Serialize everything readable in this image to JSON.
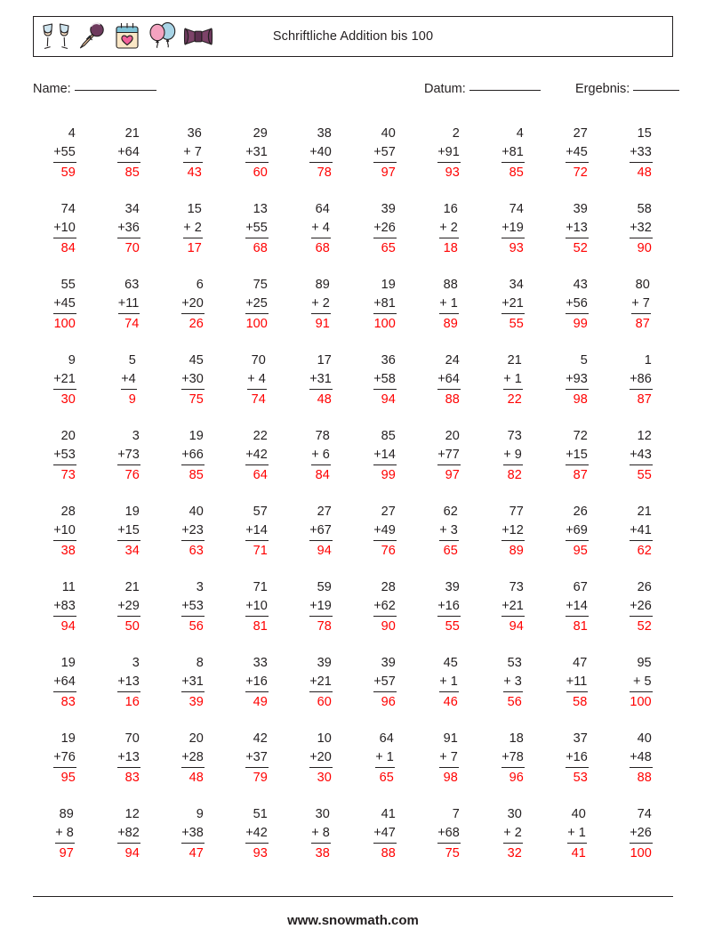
{
  "header": {
    "title": "Schriftliche Addition bis 100",
    "icons": [
      "champagne-glasses-icon",
      "microphone-icon",
      "calendar-heart-icon",
      "balloons-icon",
      "bow-tie-icon"
    ]
  },
  "meta": {
    "name_label": "Name:",
    "date_label": "Datum:",
    "score_label": "Ergebnis:",
    "name_value": "",
    "date_value": "",
    "score_value": ""
  },
  "footer": {
    "site": "www.snowmath.com"
  },
  "colors": {
    "ink": "#231f20",
    "answer": "#ff0000",
    "page": "#ffffff"
  },
  "worksheet": {
    "operator": "+",
    "columns": 10,
    "rows": 10,
    "total_problems": 100,
    "problems": [
      {
        "a": "4",
        "b": "55",
        "sum": "59"
      },
      {
        "a": "21",
        "b": "64",
        "sum": "85"
      },
      {
        "a": "36",
        "b": "7",
        "sum": "43"
      },
      {
        "a": "29",
        "b": "31",
        "sum": "60"
      },
      {
        "a": "38",
        "b": "40",
        "sum": "78"
      },
      {
        "a": "40",
        "b": "57",
        "sum": "97"
      },
      {
        "a": "2",
        "b": "91",
        "sum": "93"
      },
      {
        "a": "4",
        "b": "81",
        "sum": "85"
      },
      {
        "a": "27",
        "b": "45",
        "sum": "72"
      },
      {
        "a": "15",
        "b": "33",
        "sum": "48"
      },
      {
        "a": "74",
        "b": "10",
        "sum": "84"
      },
      {
        "a": "34",
        "b": "36",
        "sum": "70"
      },
      {
        "a": "15",
        "b": "2",
        "sum": "17"
      },
      {
        "a": "13",
        "b": "55",
        "sum": "68"
      },
      {
        "a": "64",
        "b": "4",
        "sum": "68"
      },
      {
        "a": "39",
        "b": "26",
        "sum": "65"
      },
      {
        "a": "16",
        "b": "2",
        "sum": "18"
      },
      {
        "a": "74",
        "b": "19",
        "sum": "93"
      },
      {
        "a": "39",
        "b": "13",
        "sum": "52"
      },
      {
        "a": "58",
        "b": "32",
        "sum": "90"
      },
      {
        "a": "55",
        "b": "45",
        "sum": "100"
      },
      {
        "a": "63",
        "b": "11",
        "sum": "74"
      },
      {
        "a": "6",
        "b": "20",
        "sum": "26"
      },
      {
        "a": "75",
        "b": "25",
        "sum": "100"
      },
      {
        "a": "89",
        "b": "2",
        "sum": "91"
      },
      {
        "a": "19",
        "b": "81",
        "sum": "100"
      },
      {
        "a": "88",
        "b": "1",
        "sum": "89"
      },
      {
        "a": "34",
        "b": "21",
        "sum": "55"
      },
      {
        "a": "43",
        "b": "56",
        "sum": "99"
      },
      {
        "a": "80",
        "b": "7",
        "sum": "87"
      },
      {
        "a": "9",
        "b": "21",
        "sum": "30"
      },
      {
        "a": "5",
        "b": "4",
        "sum": "9",
        "narrow": true
      },
      {
        "a": "45",
        "b": "30",
        "sum": "75"
      },
      {
        "a": "70",
        "b": "4",
        "sum": "74"
      },
      {
        "a": "17",
        "b": "31",
        "sum": "48"
      },
      {
        "a": "36",
        "b": "58",
        "sum": "94"
      },
      {
        "a": "24",
        "b": "64",
        "sum": "88"
      },
      {
        "a": "21",
        "b": "1",
        "sum": "22"
      },
      {
        "a": "5",
        "b": "93",
        "sum": "98"
      },
      {
        "a": "1",
        "b": "86",
        "sum": "87"
      },
      {
        "a": "20",
        "b": "53",
        "sum": "73"
      },
      {
        "a": "3",
        "b": "73",
        "sum": "76"
      },
      {
        "a": "19",
        "b": "66",
        "sum": "85"
      },
      {
        "a": "22",
        "b": "42",
        "sum": "64"
      },
      {
        "a": "78",
        "b": "6",
        "sum": "84"
      },
      {
        "a": "85",
        "b": "14",
        "sum": "99"
      },
      {
        "a": "20",
        "b": "77",
        "sum": "97"
      },
      {
        "a": "73",
        "b": "9",
        "sum": "82"
      },
      {
        "a": "72",
        "b": "15",
        "sum": "87"
      },
      {
        "a": "12",
        "b": "43",
        "sum": "55"
      },
      {
        "a": "28",
        "b": "10",
        "sum": "38"
      },
      {
        "a": "19",
        "b": "15",
        "sum": "34"
      },
      {
        "a": "40",
        "b": "23",
        "sum": "63"
      },
      {
        "a": "57",
        "b": "14",
        "sum": "71"
      },
      {
        "a": "27",
        "b": "67",
        "sum": "94"
      },
      {
        "a": "27",
        "b": "49",
        "sum": "76"
      },
      {
        "a": "62",
        "b": "3",
        "sum": "65"
      },
      {
        "a": "77",
        "b": "12",
        "sum": "89"
      },
      {
        "a": "26",
        "b": "69",
        "sum": "95"
      },
      {
        "a": "21",
        "b": "41",
        "sum": "62"
      },
      {
        "a": "11",
        "b": "83",
        "sum": "94"
      },
      {
        "a": "21",
        "b": "29",
        "sum": "50"
      },
      {
        "a": "3",
        "b": "53",
        "sum": "56"
      },
      {
        "a": "71",
        "b": "10",
        "sum": "81"
      },
      {
        "a": "59",
        "b": "19",
        "sum": "78"
      },
      {
        "a": "28",
        "b": "62",
        "sum": "90"
      },
      {
        "a": "39",
        "b": "16",
        "sum": "55"
      },
      {
        "a": "73",
        "b": "21",
        "sum": "94"
      },
      {
        "a": "67",
        "b": "14",
        "sum": "81"
      },
      {
        "a": "26",
        "b": "26",
        "sum": "52"
      },
      {
        "a": "19",
        "b": "64",
        "sum": "83"
      },
      {
        "a": "3",
        "b": "13",
        "sum": "16"
      },
      {
        "a": "8",
        "b": "31",
        "sum": "39"
      },
      {
        "a": "33",
        "b": "16",
        "sum": "49"
      },
      {
        "a": "39",
        "b": "21",
        "sum": "60"
      },
      {
        "a": "39",
        "b": "57",
        "sum": "96"
      },
      {
        "a": "45",
        "b": "1",
        "sum": "46"
      },
      {
        "a": "53",
        "b": "3",
        "sum": "56"
      },
      {
        "a": "47",
        "b": "11",
        "sum": "58"
      },
      {
        "a": "95",
        "b": "5",
        "sum": "100"
      },
      {
        "a": "19",
        "b": "76",
        "sum": "95"
      },
      {
        "a": "70",
        "b": "13",
        "sum": "83"
      },
      {
        "a": "20",
        "b": "28",
        "sum": "48"
      },
      {
        "a": "42",
        "b": "37",
        "sum": "79"
      },
      {
        "a": "10",
        "b": "20",
        "sum": "30"
      },
      {
        "a": "64",
        "b": "1",
        "sum": "65"
      },
      {
        "a": "91",
        "b": "7",
        "sum": "98"
      },
      {
        "a": "18",
        "b": "78",
        "sum": "96"
      },
      {
        "a": "37",
        "b": "16",
        "sum": "53"
      },
      {
        "a": "40",
        "b": "48",
        "sum": "88"
      },
      {
        "a": "89",
        "b": "8",
        "sum": "97"
      },
      {
        "a": "12",
        "b": "82",
        "sum": "94"
      },
      {
        "a": "9",
        "b": "38",
        "sum": "47"
      },
      {
        "a": "51",
        "b": "42",
        "sum": "93"
      },
      {
        "a": "30",
        "b": "8",
        "sum": "38"
      },
      {
        "a": "41",
        "b": "47",
        "sum": "88"
      },
      {
        "a": "7",
        "b": "68",
        "sum": "75"
      },
      {
        "a": "30",
        "b": "2",
        "sum": "32"
      },
      {
        "a": "40",
        "b": "1",
        "sum": "41"
      },
      {
        "a": "74",
        "b": "26",
        "sum": "100"
      }
    ]
  }
}
